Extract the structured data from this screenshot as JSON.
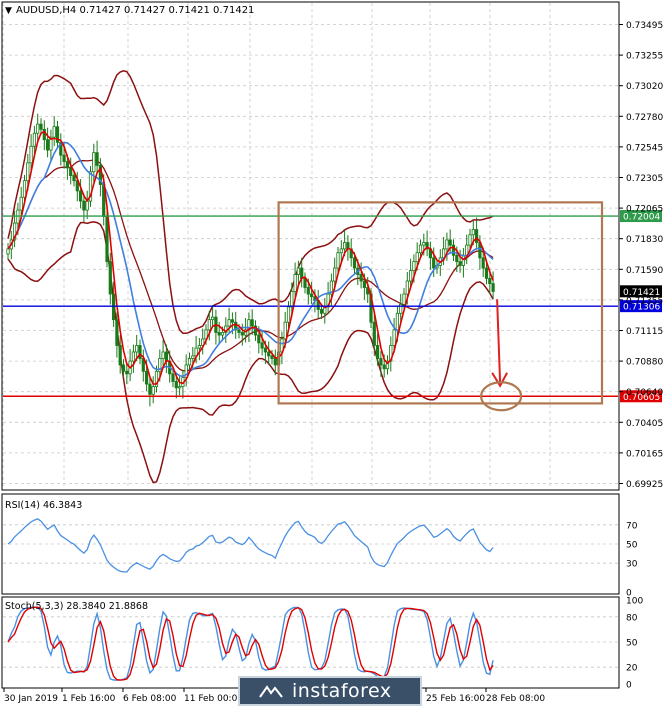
{
  "header": {
    "menu_glyph": "▼",
    "symbol_info": "AUDUSD,H4  0.71427 0.71427 0.71421 0.71421"
  },
  "indicators": {
    "rsi_label": "RSI(14) 46.3843",
    "stoch_label": "Stoch(5,3,3) 28.3840 21.8868"
  },
  "watermark": "instaforex",
  "colors": {
    "candle": "#1a7a1a",
    "bollinger": "#8b1010",
    "ma_fast": "#e00000",
    "ma_slow": "#3f7fe0",
    "green_level": "#2e9b4a",
    "blue_level": "#0000dd",
    "red_level": "#e00000",
    "range_box": "#b07850",
    "forecast_arrow": "#e02020",
    "rsi_line": "#4a90e2",
    "stoch_main": "#4a90e2",
    "stoch_signal": "#e00000"
  },
  "chart_data": {
    "type": "candlestick",
    "symbol": "AUDUSD",
    "timeframe": "H4",
    "price_axis_ticks": [
      "0.73495",
      "0.73255",
      "0.73020",
      "0.72780",
      "0.72545",
      "0.72305",
      "0.72065",
      "0.71830",
      "0.71590",
      "0.71355",
      "0.71115",
      "0.70880",
      "0.70640",
      "0.70405",
      "0.70165",
      "0.69925"
    ],
    "ylim": [
      0.699,
      0.736
    ],
    "x_ticks": [
      "30 Jan 2019",
      "1 Feb 16:00",
      "6 Feb 08:00",
      "11 Feb 00:00",
      "25 Feb 16:00",
      "28 Feb 08:00"
    ],
    "current_price_label": "0.71421",
    "levels": [
      {
        "label": "0.72004",
        "value": 0.72004,
        "color": "green"
      },
      {
        "label": "0.71306",
        "value": 0.71306,
        "color": "blue"
      },
      {
        "label": "0.70605",
        "value": 0.70605,
        "color": "red"
      }
    ],
    "range_box": {
      "y_from": 0.7055,
      "y_to": 0.7211,
      "x_from_bar": 82,
      "x_to_bar": 180
    },
    "forecast_arrow": {
      "from": 0.7136,
      "to": 0.7071
    },
    "close_series": [
      0.7175,
      0.7182,
      0.7195,
      0.7205,
      0.7215,
      0.7228,
      0.7242,
      0.7255,
      0.7265,
      0.7272,
      0.7268,
      0.726,
      0.7252,
      0.7262,
      0.727,
      0.7258,
      0.7248,
      0.7243,
      0.7238,
      0.7232,
      0.7228,
      0.722,
      0.7212,
      0.7205,
      0.7212,
      0.7235,
      0.725,
      0.724,
      0.7225,
      0.72,
      0.7165,
      0.714,
      0.712,
      0.71,
      0.7085,
      0.708,
      0.7078,
      0.7088,
      0.7095,
      0.71,
      0.709,
      0.708,
      0.707,
      0.7062,
      0.7068,
      0.708,
      0.709,
      0.7095,
      0.7088,
      0.7078,
      0.7072,
      0.7067,
      0.7068,
      0.7075,
      0.7085,
      0.709,
      0.7092,
      0.7098,
      0.71,
      0.7105,
      0.7112,
      0.712,
      0.7122,
      0.711,
      0.7108,
      0.711,
      0.7115,
      0.712,
      0.7118,
      0.7112,
      0.711,
      0.7108,
      0.7112,
      0.712,
      0.7115,
      0.7108,
      0.7102,
      0.7098,
      0.7095,
      0.7092,
      0.709,
      0.7085,
      0.7095,
      0.7105,
      0.7118,
      0.713,
      0.7142,
      0.7155,
      0.716,
      0.7152,
      0.7145,
      0.714,
      0.7138,
      0.7135,
      0.7128,
      0.7125,
      0.713,
      0.714,
      0.715,
      0.716,
      0.7172,
      0.7175,
      0.718,
      0.7175,
      0.7168,
      0.716,
      0.7155,
      0.715,
      0.7145,
      0.714,
      0.7118,
      0.71,
      0.709,
      0.7085,
      0.7082,
      0.7088,
      0.71,
      0.7112,
      0.7125,
      0.7132,
      0.714,
      0.715,
      0.7158,
      0.7165,
      0.7172,
      0.7178,
      0.718,
      0.7175,
      0.7168,
      0.716,
      0.7162,
      0.7168,
      0.7175,
      0.7182,
      0.7178,
      0.717,
      0.7165,
      0.7162,
      0.717,
      0.7178,
      0.7186,
      0.719,
      0.718,
      0.7168,
      0.716,
      0.7152,
      0.7148,
      0.7142
    ],
    "rsi": {
      "range": [
        0,
        100
      ],
      "ticks": [
        "70",
        "50",
        "30",
        "0"
      ],
      "current": 46.3843
    },
    "stochastic": {
      "range": [
        0,
        100
      ],
      "ticks": [
        "100",
        "80",
        "50",
        "20",
        "0"
      ],
      "main": 28.384,
      "signal": 21.8868
    }
  }
}
